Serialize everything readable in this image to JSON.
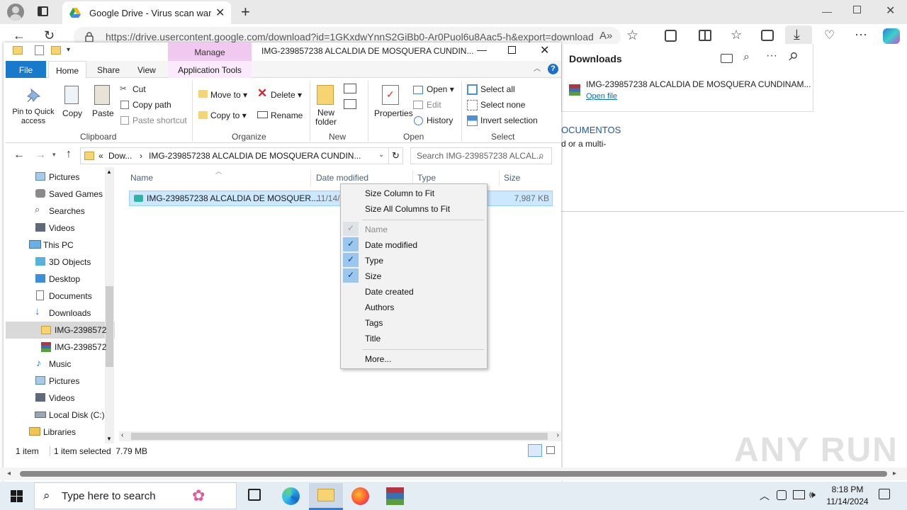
{
  "browser": {
    "tab_title": "Google Drive - Virus scan warning",
    "url": "https://drive.usercontent.google.com/download?id=1GKxdwYnnS2GiBb0-Ar0Puol6u8Aac5-h&export=download"
  },
  "downloads": {
    "title": "Downloads",
    "file_name": "IMG-239857238 ALCALDIA DE MOSQUERA CUNDINAM...",
    "open_link": "Open file"
  },
  "page": {
    "line1": "OCUMENTOS",
    "line2": "d or a multi-"
  },
  "explorer": {
    "context_tab": "Manage",
    "window_title": "IMG-239857238 ALCALDIA DE MOSQUERA CUNDIN...",
    "tabs": [
      "File",
      "Home",
      "Share",
      "View",
      "Application Tools"
    ],
    "clipboard": {
      "pin": "Pin to Quick access",
      "copy": "Copy",
      "paste": "Paste",
      "cut": "Cut",
      "copy_path": "Copy path",
      "paste_shortcut": "Paste shortcut",
      "group": "Clipboard"
    },
    "organize": {
      "move_to": "Move to",
      "copy_to": "Copy to",
      "delete": "Delete",
      "rename": "Rename",
      "group": "Organize"
    },
    "new": {
      "new_folder": "New folder",
      "group": "New"
    },
    "open": {
      "properties": "Properties",
      "open": "Open",
      "edit": "Edit",
      "history": "History",
      "group": "Open"
    },
    "select": {
      "all": "Select all",
      "none": "Select none",
      "invert": "Invert selection",
      "group": "Select"
    },
    "breadcrumb": {
      "prefix": "«",
      "part1": "Dow...",
      "sep": "›",
      "part2": "IMG-239857238 ALCALDIA DE MOSQUERA CUNDIN..."
    },
    "search_placeholder": "Search IMG-239857238 ALCAL...",
    "nav": [
      "Pictures",
      "Saved Games",
      "Searches",
      "Videos",
      "This PC",
      "3D Objects",
      "Desktop",
      "Documents",
      "Downloads",
      "IMG-2398572",
      "IMG-2398572",
      "Music",
      "Pictures",
      "Videos",
      "Local Disk (C:)",
      "Libraries"
    ],
    "columns": [
      "Name",
      "Date modified",
      "Type",
      "Size"
    ],
    "file": {
      "name": "IMG-239857238 ALCALDIA DE MOSQUER...",
      "date": "11/14/",
      "size": "7,987 KB"
    },
    "status": {
      "count": "1 item",
      "selected": "1 item selected  7.79 MB"
    }
  },
  "context_menu": {
    "items": [
      "Size Column to Fit",
      "Size All Columns to Fit",
      "Name",
      "Date modified",
      "Type",
      "Size",
      "Date created",
      "Authors",
      "Tags",
      "Title",
      "More..."
    ]
  },
  "taskbar": {
    "search_placeholder": "Type here to search",
    "time": "8:18 PM",
    "date": "11/14/2024"
  },
  "watermark": "ANY RUN"
}
